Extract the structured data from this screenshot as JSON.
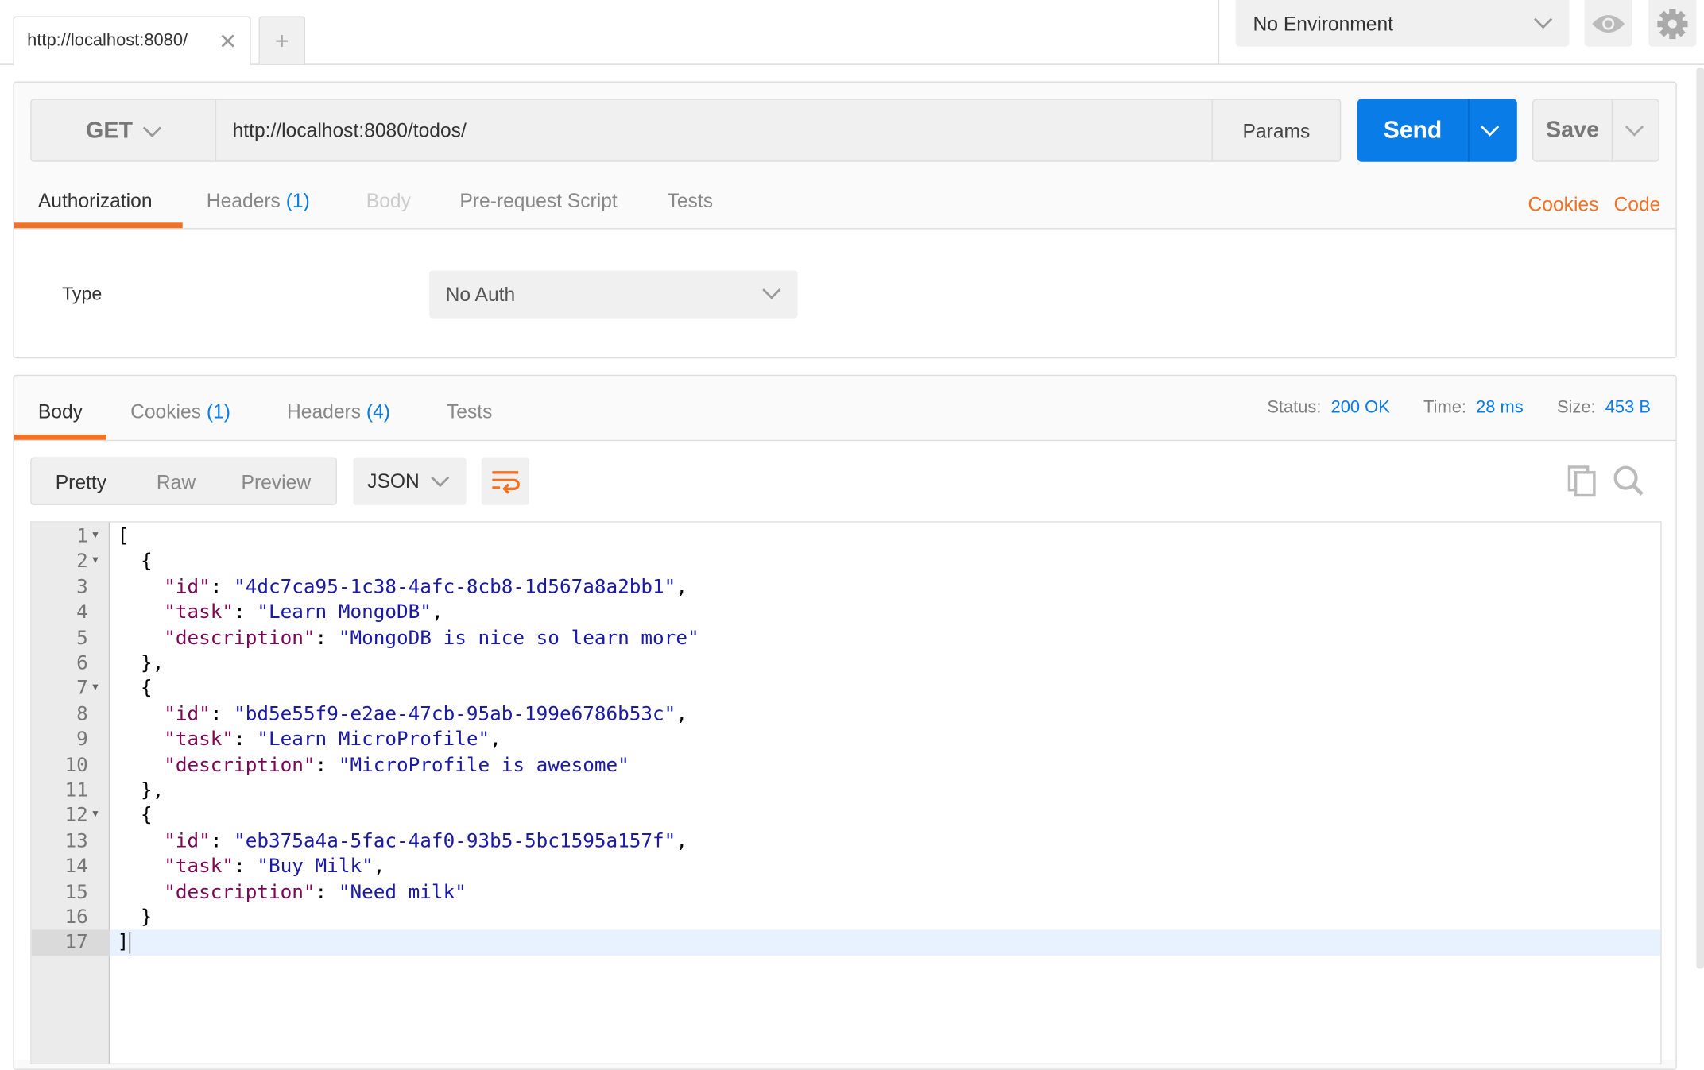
{
  "tabs": {
    "active_tab": "http://localhost:8080/",
    "close_icon": "close-icon",
    "new_tab": "+"
  },
  "environment": {
    "selected": "No Environment"
  },
  "icons": {
    "eye": "eye-icon",
    "gear": "gear-icon",
    "copy": "copy-icon",
    "search": "search-icon",
    "wrap": "wrap-lines-icon"
  },
  "request": {
    "method": "GET",
    "url": "http://localhost:8080/todos/",
    "params_label": "Params",
    "send_label": "Send",
    "save_label": "Save",
    "tabs": [
      {
        "label": "Authorization",
        "count": ""
      },
      {
        "label": "Headers",
        "count": "(1)"
      },
      {
        "label": "Body",
        "count": ""
      },
      {
        "label": "Pre-request Script",
        "count": ""
      },
      {
        "label": "Tests",
        "count": ""
      }
    ],
    "cookies_link": "Cookies",
    "code_link": "Code",
    "auth": {
      "type_label": "Type",
      "type_value": "No Auth"
    }
  },
  "response": {
    "tabs": [
      {
        "label": "Body",
        "count": ""
      },
      {
        "label": "Cookies",
        "count": "(1)"
      },
      {
        "label": "Headers",
        "count": "(4)"
      },
      {
        "label": "Tests",
        "count": ""
      }
    ],
    "status_label": "Status:",
    "status_value": "200 OK",
    "time_label": "Time:",
    "time_value": "28 ms",
    "size_label": "Size:",
    "size_value": "453 B",
    "view_modes": [
      "Pretty",
      "Raw",
      "Preview"
    ],
    "format": "JSON",
    "lines": [
      {
        "n": "1",
        "fold": true,
        "indent": "",
        "tokens": [
          [
            "p",
            "["
          ]
        ]
      },
      {
        "n": "2",
        "fold": true,
        "indent": "  ",
        "tokens": [
          [
            "p",
            "{"
          ]
        ]
      },
      {
        "n": "3",
        "fold": false,
        "indent": "    ",
        "tokens": [
          [
            "k",
            "\"id\""
          ],
          [
            "p",
            ": "
          ],
          [
            "s",
            "\"4dc7ca95-1c38-4afc-8cb8-1d567a8a2bb1\""
          ],
          [
            "p",
            ","
          ]
        ]
      },
      {
        "n": "4",
        "fold": false,
        "indent": "    ",
        "tokens": [
          [
            "k",
            "\"task\""
          ],
          [
            "p",
            ": "
          ],
          [
            "s",
            "\"Learn MongoDB\""
          ],
          [
            "p",
            ","
          ]
        ]
      },
      {
        "n": "5",
        "fold": false,
        "indent": "    ",
        "tokens": [
          [
            "k",
            "\"description\""
          ],
          [
            "p",
            ": "
          ],
          [
            "s",
            "\"MongoDB is nice so learn more\""
          ]
        ]
      },
      {
        "n": "6",
        "fold": false,
        "indent": "  ",
        "tokens": [
          [
            "p",
            "},"
          ]
        ]
      },
      {
        "n": "7",
        "fold": true,
        "indent": "  ",
        "tokens": [
          [
            "p",
            "{"
          ]
        ]
      },
      {
        "n": "8",
        "fold": false,
        "indent": "    ",
        "tokens": [
          [
            "k",
            "\"id\""
          ],
          [
            "p",
            ": "
          ],
          [
            "s",
            "\"bd5e55f9-e2ae-47cb-95ab-199e6786b53c\""
          ],
          [
            "p",
            ","
          ]
        ]
      },
      {
        "n": "9",
        "fold": false,
        "indent": "    ",
        "tokens": [
          [
            "k",
            "\"task\""
          ],
          [
            "p",
            ": "
          ],
          [
            "s",
            "\"Learn MicroProfile\""
          ],
          [
            "p",
            ","
          ]
        ]
      },
      {
        "n": "10",
        "fold": false,
        "indent": "    ",
        "tokens": [
          [
            "k",
            "\"description\""
          ],
          [
            "p",
            ": "
          ],
          [
            "s",
            "\"MicroProfile is awesome\""
          ]
        ]
      },
      {
        "n": "11",
        "fold": false,
        "indent": "  ",
        "tokens": [
          [
            "p",
            "},"
          ]
        ]
      },
      {
        "n": "12",
        "fold": true,
        "indent": "  ",
        "tokens": [
          [
            "p",
            "{"
          ]
        ]
      },
      {
        "n": "13",
        "fold": false,
        "indent": "    ",
        "tokens": [
          [
            "k",
            "\"id\""
          ],
          [
            "p",
            ": "
          ],
          [
            "s",
            "\"eb375a4a-5fac-4af0-93b5-5bc1595a157f\""
          ],
          [
            "p",
            ","
          ]
        ]
      },
      {
        "n": "14",
        "fold": false,
        "indent": "    ",
        "tokens": [
          [
            "k",
            "\"task\""
          ],
          [
            "p",
            ": "
          ],
          [
            "s",
            "\"Buy Milk\""
          ],
          [
            "p",
            ","
          ]
        ]
      },
      {
        "n": "15",
        "fold": false,
        "indent": "    ",
        "tokens": [
          [
            "k",
            "\"description\""
          ],
          [
            "p",
            ": "
          ],
          [
            "s",
            "\"Need milk\""
          ]
        ]
      },
      {
        "n": "16",
        "fold": false,
        "indent": "  ",
        "tokens": [
          [
            "p",
            "}"
          ]
        ]
      },
      {
        "n": "17",
        "fold": false,
        "indent": "",
        "tokens": [
          [
            "p",
            "]"
          ]
        ],
        "current": true
      }
    ]
  },
  "colors": {
    "accent_orange": "#f47023",
    "send_blue": "#0a7ce8",
    "json_key": "#7a0854",
    "json_string": "#1a1aa6"
  }
}
